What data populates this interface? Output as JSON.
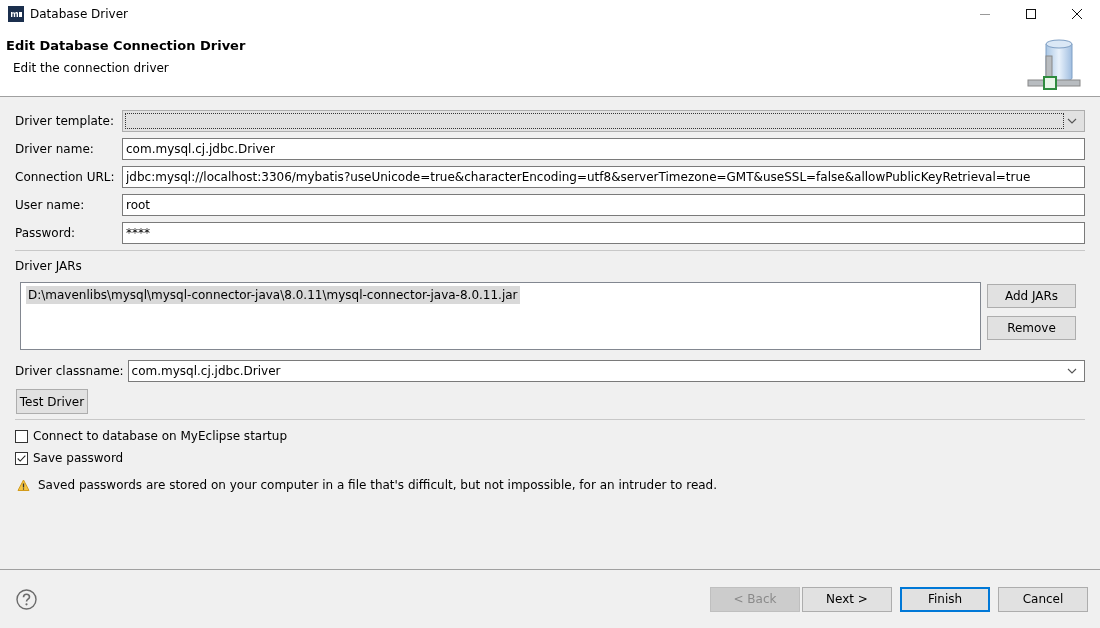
{
  "window": {
    "title": "Database Driver"
  },
  "header": {
    "title": "Edit Database Connection Driver",
    "subtitle": "Edit the connection driver"
  },
  "fields": [
    {
      "kind": "combo",
      "label": "Driver template:"
    },
    {
      "kind": "text",
      "label": "Driver name:",
      "value": "com.mysql.cj.jdbc.Driver"
    },
    {
      "kind": "text",
      "label": "Connection URL:",
      "value": "jdbc:mysql://localhost:3306/mybatis?useUnicode=true&characterEncoding=utf8&serverTimezone=GMT&useSSL=false&allowPublicKeyRetrieval=true"
    },
    {
      "kind": "text",
      "label": "User name:",
      "value": "root"
    },
    {
      "kind": "text",
      "label": "Password:",
      "value": "****"
    }
  ],
  "driver_jars": {
    "label": "Driver JARs",
    "items": [
      {
        "path": "D:\\mavenlibs\\mysql\\mysql-connector-java\\8.0.11\\mysql-connector-java-8.0.11.jar",
        "selected": true
      }
    ],
    "buttons": [
      "Add JARs",
      "Remove"
    ]
  },
  "classname": {
    "label": "Driver classname:",
    "value": "com.mysql.cj.jdbc.Driver"
  },
  "test_button": "Test Driver",
  "options": [
    {
      "label": "Connect to database on MyEclipse startup",
      "checked": false
    },
    {
      "label": "Save password",
      "checked": true
    }
  ],
  "warning": "Saved passwords are stored on your computer in a file that's difficult, but not impossible, for an intruder to read.",
  "buttons": [
    {
      "label": "< Back",
      "disabled": true,
      "default": false
    },
    {
      "label": "Next >",
      "disabled": false,
      "default": false
    },
    {
      "label": "Finish",
      "disabled": false,
      "default": true
    },
    {
      "label": "Cancel",
      "disabled": false,
      "default": false
    }
  ]
}
